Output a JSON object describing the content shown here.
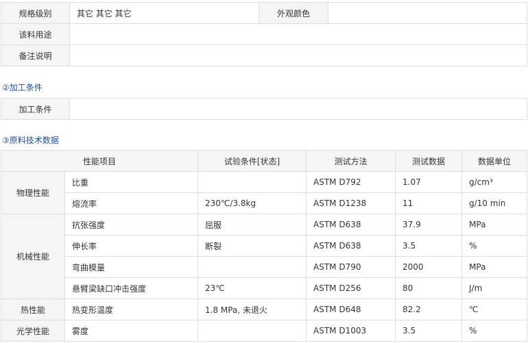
{
  "basic_info": {
    "rows": [
      {
        "label": "规格级别",
        "value": "其它 其它 其它",
        "label2": "外观颜色",
        "value2": ""
      },
      {
        "label": "该料用途",
        "value": ""
      },
      {
        "label": "备注说明",
        "value": ""
      }
    ]
  },
  "processing": {
    "title": "②加工条件",
    "label": "加工条件",
    "value": ""
  },
  "tech_data": {
    "title": "③原料技术数据",
    "headers": [
      "性能项目",
      "试验条件[状态]",
      "测试方法",
      "测试数据",
      "数据单位"
    ],
    "groups": {
      "physical": "物理性能",
      "mechanical": "机械性能",
      "thermal": "热性能",
      "optical": "光学性能"
    },
    "rows": [
      {
        "item": "比重",
        "condition": "",
        "method": "ASTM D792",
        "value": "1.07",
        "unit": "g/cm³"
      },
      {
        "item": "熔流率",
        "condition": "230℃/3.8kg",
        "method": "ASTM D1238",
        "value": "11",
        "unit": "g/10 min"
      },
      {
        "item": "抗张强度",
        "condition": "屈服",
        "method": "ASTM D638",
        "value": "37.9",
        "unit": "MPa"
      },
      {
        "item": "伸长率",
        "condition": "断裂",
        "method": "ASTM D638",
        "value": "3.5",
        "unit": "%"
      },
      {
        "item": "弯曲模量",
        "condition": "",
        "method": "ASTM D790",
        "value": "2000",
        "unit": "MPa"
      },
      {
        "item": "悬臂梁缺口冲击强度",
        "condition": "23℃",
        "method": "ASTM D256",
        "value": "80",
        "unit": "J/m"
      },
      {
        "item": "热变形温度",
        "condition": "1.8 MPa, 未退火",
        "method": "ASTM D648",
        "value": "82.2",
        "unit": "℃"
      },
      {
        "item": "雾度",
        "condition": "",
        "method": "ASTM D1003",
        "value": "3.5",
        "unit": "%"
      }
    ]
  }
}
